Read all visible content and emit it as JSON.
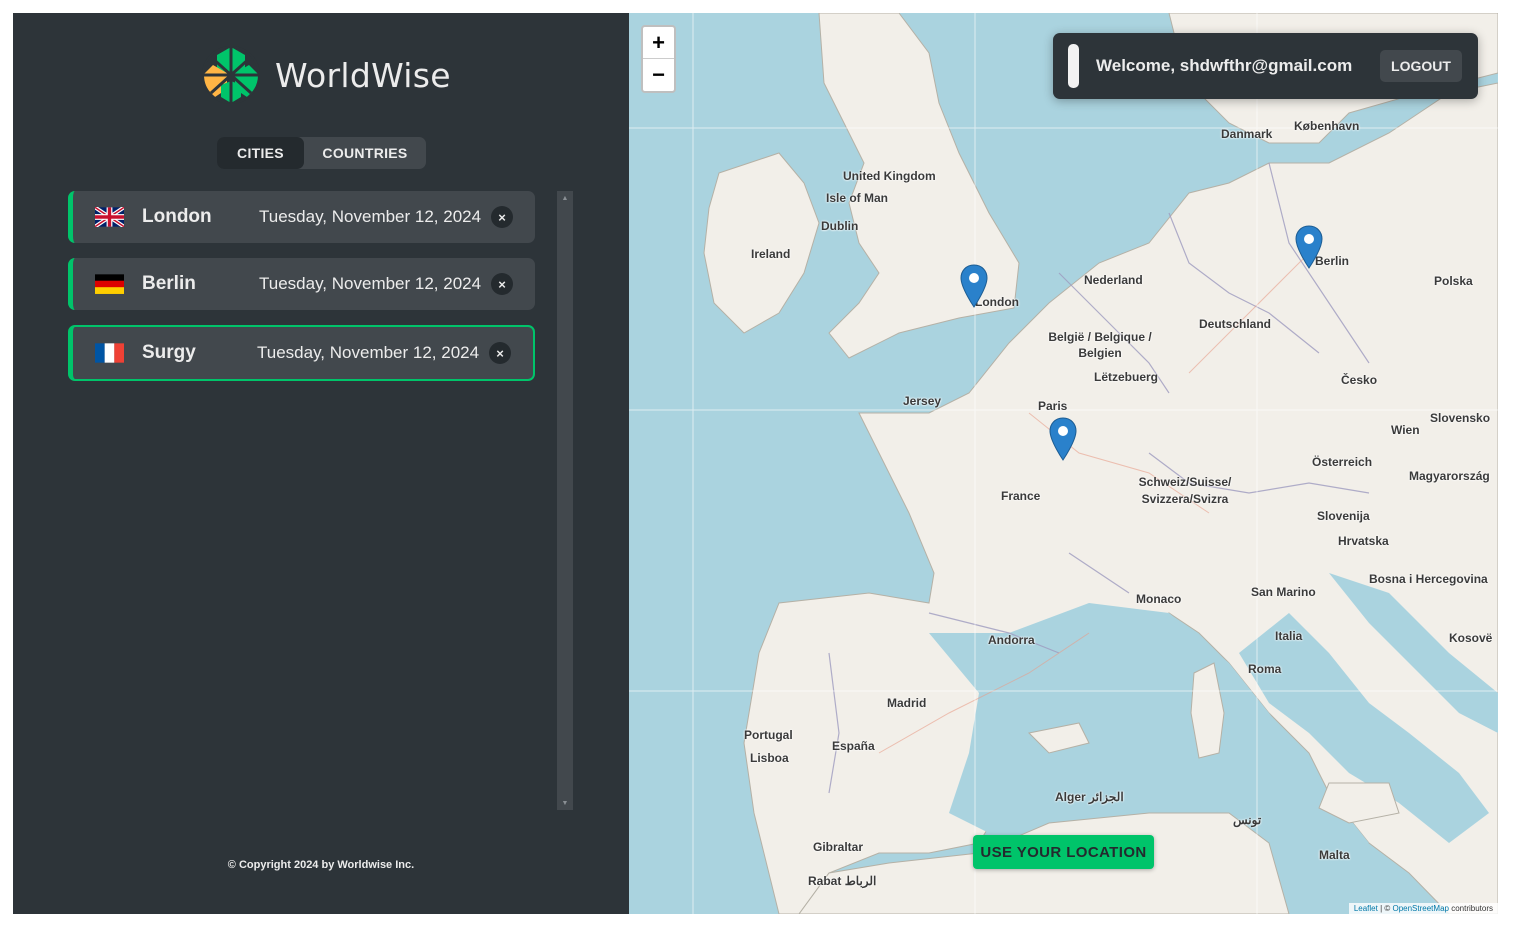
{
  "app": {
    "name": "WorldWise"
  },
  "tabs": [
    {
      "label": "CITIES",
      "active": true
    },
    {
      "label": "COUNTRIES",
      "active": false
    }
  ],
  "cities": [
    {
      "flag": "gb-flag-icon",
      "name": "London",
      "date": "Tuesday, November 12, 2024",
      "active": false
    },
    {
      "flag": "de-flag-icon",
      "name": "Berlin",
      "date": "Tuesday, November 12, 2024",
      "active": false
    },
    {
      "flag": "fr-flag-icon",
      "name": "Surgy",
      "date": "Tuesday, November 12, 2024",
      "active": true
    }
  ],
  "delete_glyph": "×",
  "footer": {
    "copyright": "© Copyright 2024 by Worldwise Inc."
  },
  "map": {
    "zoom_in": "+",
    "zoom_out": "−",
    "welcome": "Welcome, shdwfthr@gmail.com",
    "logout": "LOGOUT",
    "use_location": "USE YOUR LOCATION",
    "attribution": {
      "leaflet": "Leaflet",
      "sep": " | © ",
      "osm": "OpenStreetMap",
      "tail": " contributors"
    },
    "labels": [
      "United Kingdom",
      "Isle of Man",
      "Dublin",
      "Ireland",
      "London",
      "Danmark",
      "København",
      "Nederland",
      "Berlin",
      "Polska",
      "België / Belgique / Belgien",
      "Deutschland",
      "Lëtzebuerg",
      "Česko",
      "Jersey",
      "Paris",
      "Wien",
      "Slovensko",
      "Österreich",
      "Magyarország",
      "France",
      "Schweiz/Suisse/ Svizzera/Svizra",
      "Slovenija",
      "Hrvatska",
      "Bosna i Hercegovina",
      "Monaco",
      "San Marino",
      "Italia",
      "Roma",
      "Andorra",
      "Madrid",
      "Portugal",
      "España",
      "Lisboa",
      "Kosovë",
      "Alger الجزائر",
      "تونس",
      "Gibraltar",
      "Rabat الرباط",
      "Malta"
    ]
  },
  "colors": {
    "sidebar_bg": "#2d3439",
    "item_bg": "#42484d",
    "accent": "#00c46a",
    "text": "#ececec",
    "sea": "#aad3df"
  }
}
